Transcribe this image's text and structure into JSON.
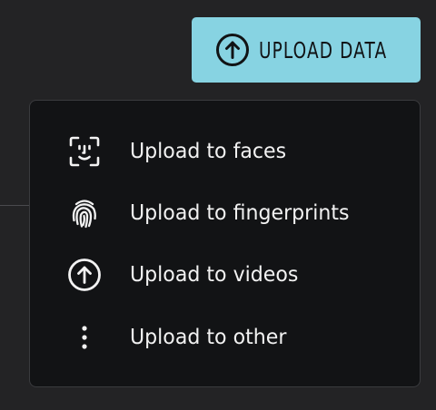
{
  "upload_button": {
    "label": "UPLOAD DATA",
    "icon": "arrow-up-circle-icon"
  },
  "menu": {
    "items": [
      {
        "label": "Upload to faces",
        "icon": "face-scan-icon"
      },
      {
        "label": "Upload to fingerprints",
        "icon": "fingerprint-icon"
      },
      {
        "label": "Upload to videos",
        "icon": "arrow-up-circle-icon"
      },
      {
        "label": "Upload to other",
        "icon": "more-vertical-icon"
      }
    ]
  },
  "colors": {
    "background": "#232325",
    "button_bg": "#87d3e2",
    "button_text": "#111315",
    "menu_bg": "#121315",
    "menu_border": "#3a3b3e",
    "menu_text": "#f2f2f2"
  }
}
